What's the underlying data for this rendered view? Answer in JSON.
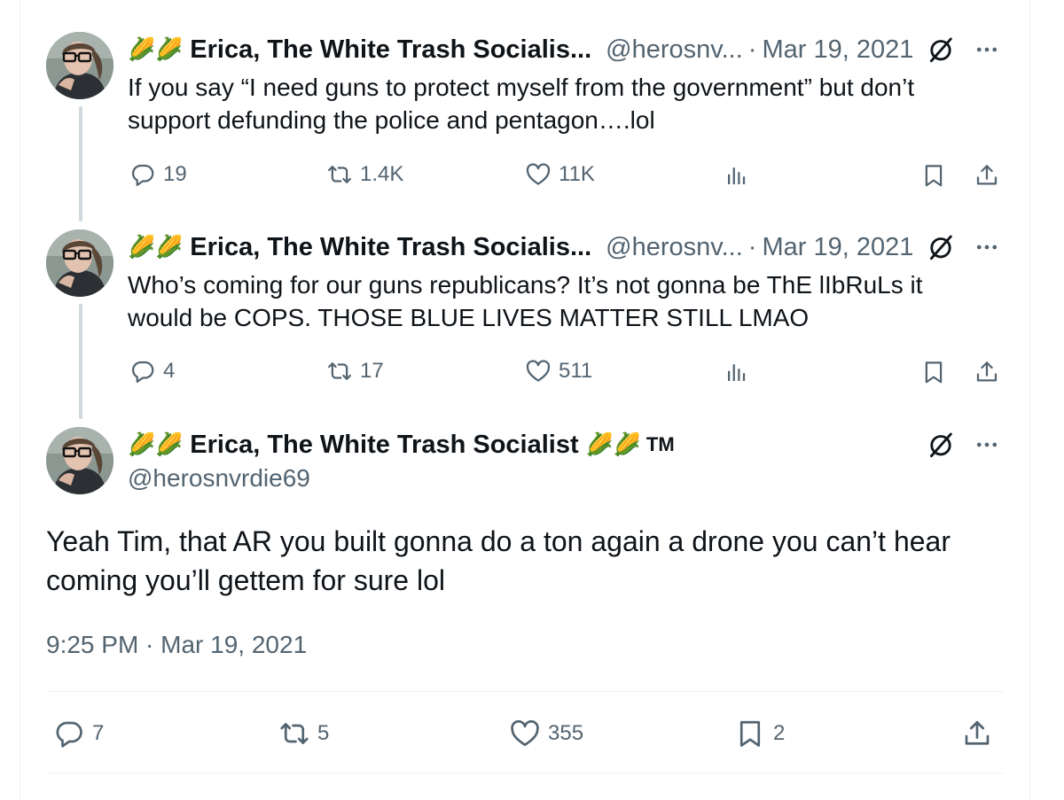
{
  "tweets": [
    {
      "corn_badges": "🌽🌽",
      "display_name": "Erica, The White Trash Socialis...",
      "handle": "@herosnv...",
      "separator": "·",
      "date": "Mar 19, 2021",
      "text_lines": [
        "If you say “I need guns to protect myself from the government” but don’t",
        "support defunding the police and pentagon….lol"
      ],
      "replies": "19",
      "retweets": "1.4K",
      "likes": "11K"
    },
    {
      "corn_badges": "🌽🌽",
      "display_name": "Erica, The White Trash Socialis...",
      "handle": "@herosnv...",
      "separator": "·",
      "date": "Mar 19, 2021",
      "text_lines": [
        "Who’s coming for our guns republicans? It’s not gonna be ThE lIbRuLs it",
        "would be COPS. THOSE BLUE LIVES MATTER STILL LMAO"
      ],
      "replies": "4",
      "retweets": "17",
      "likes": "511"
    }
  ],
  "main_tweet": {
    "corn_badges": "🌽🌽",
    "display_name": "Erica, The White Trash Socialist",
    "trailing_badges": "🌽🌽",
    "trademark": "TM",
    "handle": "@herosnvrdie69",
    "text_lines": [
      "Yeah Tim, that AR you built gonna do a ton again a drone you can’t hear",
      "coming you’ll gettem for sure lol"
    ],
    "timestamp": "9:25 PM · Mar 19, 2021",
    "replies": "7",
    "retweets": "5",
    "likes": "355",
    "bookmarks": "2"
  },
  "icons": {
    "reply": "reply-icon",
    "retweet": "retweet-icon",
    "like": "heart-icon",
    "views": "views-chart-icon",
    "bookmark": "bookmark-icon",
    "share": "share-icon",
    "grok": "grok-icon",
    "more": "more-dots-icon"
  },
  "colors": {
    "text_primary": "#0f1419",
    "text_secondary": "#536471",
    "thread_line": "#cfd9de",
    "divider": "#eff3f4"
  }
}
